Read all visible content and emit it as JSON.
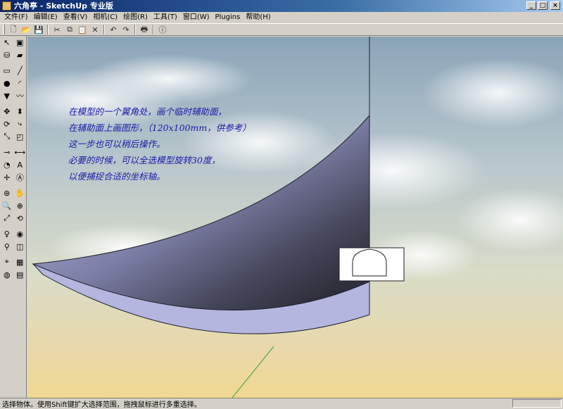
{
  "window": {
    "title": "六角亭 - SketchUp 专业版",
    "min_glyph": "_",
    "max_glyph": "□",
    "close_glyph": "×"
  },
  "menu": {
    "items": [
      {
        "label": "文件(F)"
      },
      {
        "label": "编辑(E)"
      },
      {
        "label": "查看(V)"
      },
      {
        "label": "相机(C)"
      },
      {
        "label": "绘图(R)"
      },
      {
        "label": "工具(T)"
      },
      {
        "label": "窗口(W)"
      },
      {
        "label": "Plugins"
      },
      {
        "label": "帮助(H)"
      }
    ]
  },
  "toolbar": {
    "items": [
      {
        "icon": "new-icon",
        "glyph": "🗋"
      },
      {
        "icon": "open-icon",
        "glyph": "📂"
      },
      {
        "icon": "save-icon",
        "glyph": "💾"
      },
      {
        "icon": "cut-icon",
        "glyph": "✂"
      },
      {
        "icon": "copy-icon",
        "glyph": "⧉"
      },
      {
        "icon": "paste-icon",
        "glyph": "📋"
      },
      {
        "icon": "delete-icon",
        "glyph": "✕"
      },
      {
        "icon": "undo-icon",
        "glyph": "↶"
      },
      {
        "icon": "redo-icon",
        "glyph": "↷"
      },
      {
        "icon": "print-icon",
        "glyph": "🖶"
      },
      {
        "icon": "model-info-icon",
        "glyph": "ⓘ"
      }
    ]
  },
  "tools": {
    "groups": [
      [
        [
          "select-icon",
          "↖"
        ],
        [
          "make-component-icon",
          "▣"
        ],
        [
          "paint-bucket-icon",
          "⛁"
        ],
        [
          "eraser-icon",
          "▰"
        ]
      ],
      [
        [
          "rectangle-icon",
          "▭"
        ],
        [
          "line-icon",
          "╱"
        ],
        [
          "circle-icon",
          "●"
        ],
        [
          "arc-icon",
          "◜"
        ],
        [
          "polygon-icon",
          "▼"
        ],
        [
          "freehand-icon",
          "〰"
        ]
      ],
      [
        [
          "move-icon",
          "✥"
        ],
        [
          "push-pull-icon",
          "⬍"
        ],
        [
          "rotate-icon",
          "⟳"
        ],
        [
          "follow-me-icon",
          "⤷"
        ],
        [
          "scale-icon",
          "⤡"
        ],
        [
          "offset-icon",
          "◰"
        ]
      ],
      [
        [
          "tape-measure-icon",
          "⊸"
        ],
        [
          "dimension-icon",
          "⟷"
        ],
        [
          "protractor-icon",
          "◔"
        ],
        [
          "text-icon",
          "A"
        ],
        [
          "axes-icon",
          "✛"
        ],
        [
          "3d-text-icon",
          "Ⓐ"
        ]
      ],
      [
        [
          "orbit-icon",
          "⊛"
        ],
        [
          "pan-icon",
          "✋"
        ],
        [
          "zoom-icon",
          "🔍"
        ],
        [
          "zoom-window-icon",
          "⊕"
        ],
        [
          "zoom-extents-icon",
          "⤢"
        ],
        [
          "previous-view-icon",
          "⟲"
        ]
      ],
      [
        [
          "position-camera-icon",
          "♀"
        ],
        [
          "look-around-icon",
          "◉"
        ],
        [
          "walk-icon",
          "⚲"
        ],
        [
          "section-plane-icon",
          "◫"
        ]
      ],
      [
        [
          "get-location-icon",
          "⌖"
        ],
        [
          "toggle-terrain-icon",
          "▦"
        ],
        [
          "add-location-icon",
          "◍"
        ],
        [
          "photo-textures-icon",
          "▤"
        ]
      ]
    ]
  },
  "annotation": {
    "lines": [
      "在模型的一个翼角处，画个临时辅助面，",
      "在辅助面上画图形，（120x100mm，供参考）",
      "这一步也可以稍后操作。",
      "必要的时候，可以全选模型旋转30度，",
      "以便捕捉合适的坐标轴。"
    ]
  },
  "status": {
    "text": "选择物体。使用Shift键扩大选择范围，拖拽鼠标进行多重选择。"
  },
  "colors": {
    "annotation_text": "#1a1aa8",
    "surface_dark": "#3c3d4c",
    "surface_light": "#9a9cc4",
    "surface_side": "#b4b6e0",
    "axis_green": "#3aa03a"
  }
}
